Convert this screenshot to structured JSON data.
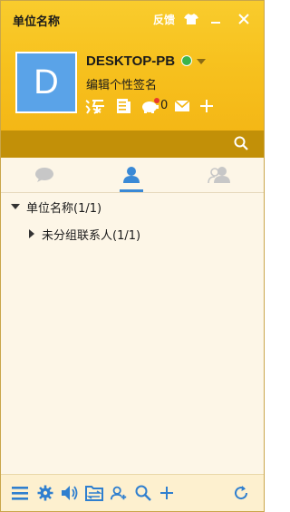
{
  "window": {
    "title": "单位名称",
    "feedback_label": "反馈",
    "skin_icon": "shirt-icon",
    "minimize_icon": "minimize-icon",
    "close_icon": "close-icon"
  },
  "profile": {
    "avatar_letter": "D",
    "avatar_color": "#5aa3e8",
    "name": "DESKTOP-PB",
    "status": "online",
    "status_color": "#3cb44a",
    "signature": "编辑个性签名",
    "quick_icons": [
      "taobao-icon",
      "document-icon",
      "piggy-bank-icon",
      "mail-icon",
      "add-icon"
    ],
    "piggy_count": "0"
  },
  "search": {
    "placeholder": "",
    "icon": "search-icon"
  },
  "tabs": [
    {
      "icon": "chat-bubble-icon",
      "active": false
    },
    {
      "icon": "contact-person-icon",
      "active": true
    },
    {
      "icon": "group-people-icon",
      "active": false
    }
  ],
  "tree": {
    "group_label": "单位名称(1/1)",
    "subgroup_label": "未分组联系人(1/1)"
  },
  "bottombar": {
    "icons": [
      "menu-icon",
      "settings-gear-icon",
      "volume-icon",
      "file-transfer-icon",
      "add-contact-icon",
      "search-icon",
      "add-icon",
      "refresh-icon"
    ],
    "accent": "#2f7fcf"
  },
  "colors": {
    "header_yellow": "#f7c21f",
    "search_bar": "#c29008",
    "panel_bg": "#fdf6e7",
    "active_tab": "#3a89d6"
  }
}
